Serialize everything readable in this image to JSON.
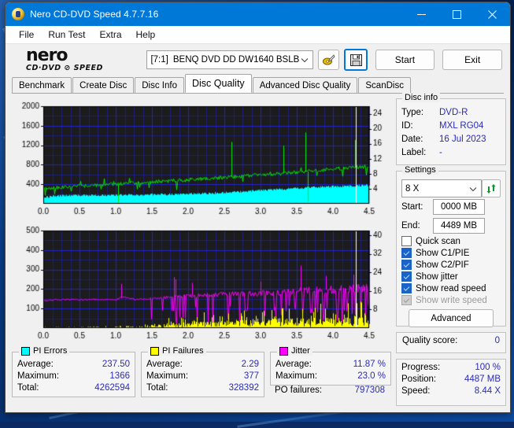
{
  "window": {
    "title": "Nero CD-DVD Speed 4.7.7.16",
    "minimize": "–",
    "maximize": "□",
    "close": "✕"
  },
  "menu": [
    "File",
    "Run Test",
    "Extra",
    "Help"
  ],
  "brand": {
    "word": "nero",
    "sub": "CD·DVD ⊘ SPEED"
  },
  "toolbar": {
    "drive_bracket": "[7:1]",
    "drive_name": "BENQ DVD DD DW1640 BSLB",
    "erase_icon": "erase-disc-icon",
    "save_icon": "save-icon",
    "start_label": "Start",
    "exit_label": "Exit"
  },
  "tabs": [
    {
      "label": "Benchmark",
      "active": false
    },
    {
      "label": "Create Disc",
      "active": false
    },
    {
      "label": "Disc Info",
      "active": false
    },
    {
      "label": "Disc Quality",
      "active": true
    },
    {
      "label": "Advanced Disc Quality",
      "active": false
    },
    {
      "label": "ScanDisc",
      "active": false
    }
  ],
  "disc_info": {
    "title": "Disc info",
    "rows": [
      {
        "label": "Type:",
        "value": "DVD-R"
      },
      {
        "label": "ID:",
        "value": "MXL RG04"
      },
      {
        "label": "Date:",
        "value": "16 Jul 2023"
      },
      {
        "label": "Label:",
        "value": "-"
      }
    ]
  },
  "settings": {
    "title": "Settings",
    "speed": "8 X",
    "refresh_icon": "refresh-icon",
    "start_label": "Start:",
    "start_value": "0000 MB",
    "end_label": "End:",
    "end_value": "4489 MB",
    "checkboxes": [
      {
        "label": "Quick scan",
        "checked": false,
        "disabled": false
      },
      {
        "label": "Show C1/PIE",
        "checked": true,
        "disabled": false
      },
      {
        "label": "Show C2/PIF",
        "checked": true,
        "disabled": false
      },
      {
        "label": "Show jitter",
        "checked": true,
        "disabled": false
      },
      {
        "label": "Show read speed",
        "checked": true,
        "disabled": false
      },
      {
        "label": "Show write speed",
        "checked": true,
        "disabled": true
      }
    ],
    "advanced_label": "Advanced"
  },
  "quality": {
    "label": "Quality score:",
    "value": "0"
  },
  "status": {
    "rows": [
      {
        "label": "Progress:",
        "value": "100 %"
      },
      {
        "label": "Position:",
        "value": "4487 MB"
      },
      {
        "label": "Speed:",
        "value": "8.44 X"
      }
    ]
  },
  "stats": [
    {
      "title": "PI Errors",
      "color": "#00ffff",
      "rows": [
        {
          "label": "Average:",
          "value": "237.50"
        },
        {
          "label": "Maximum:",
          "value": "1366"
        },
        {
          "label": "Total:",
          "value": "4262594"
        }
      ]
    },
    {
      "title": "PI Failures",
      "color": "#ffff00",
      "rows": [
        {
          "label": "Average:",
          "value": "2.29"
        },
        {
          "label": "Maximum:",
          "value": "377"
        },
        {
          "label": "Total:",
          "value": "328392"
        }
      ]
    },
    {
      "title": "Jitter",
      "color": "#ff00ff",
      "rows": [
        {
          "label": "Average:",
          "value": "11.87 %"
        },
        {
          "label": "Maximum:",
          "value": "23.0 %"
        }
      ],
      "extra": {
        "label": "PO failures:",
        "value": "797308"
      }
    }
  ],
  "chart_data": [
    {
      "type": "area",
      "name": "pi-errors-chart",
      "title": "",
      "xlabel": "",
      "ylabel": "PI Errors",
      "xlim": [
        0.0,
        4.5
      ],
      "ylim": [
        0,
        2000
      ],
      "xticks": [
        0.0,
        0.5,
        1.0,
        1.5,
        2.0,
        2.5,
        3.0,
        3.5,
        4.0,
        4.5
      ],
      "xticklabels": [
        "0.0",
        "0.5",
        "1.0",
        "1.5",
        "2.0",
        "2.5",
        "3.0",
        "3.5",
        "4.0",
        "4.5"
      ],
      "yticks": [
        400,
        800,
        1200,
        1600,
        2000
      ],
      "yticklabels": [
        "400",
        "800",
        "1200",
        "1600",
        "2000"
      ],
      "y2lim": [
        0,
        26
      ],
      "y2ticks": [
        4,
        8,
        12,
        16,
        20,
        24
      ],
      "y2ticklabels": [
        "4",
        "8",
        "12",
        "16",
        "20",
        "24"
      ],
      "grid": true,
      "background": "#1c1c1c",
      "gridcolor": "#2020d0",
      "series": [
        {
          "name": "PI Errors",
          "color": "#00ffff",
          "style": "filled-band",
          "axis": "left",
          "x": [
            0.0,
            0.15,
            0.3,
            0.5,
            0.75,
            1.0,
            1.25,
            1.5,
            1.75,
            2.0,
            2.25,
            2.5,
            2.75,
            3.0,
            3.25,
            3.5,
            3.75,
            4.0,
            4.25,
            4.45
          ],
          "values": [
            120,
            150,
            160,
            165,
            168,
            170,
            175,
            180,
            185,
            195,
            205,
            220,
            240,
            265,
            290,
            310,
            330,
            345,
            360,
            370
          ],
          "noise": 42
        },
        {
          "name": "Read speed",
          "color": "#00ee00",
          "style": "line",
          "axis": "right",
          "x": [
            0.0,
            0.15,
            0.3,
            0.5,
            0.75,
            1.0,
            1.25,
            1.5,
            1.75,
            2.0,
            2.25,
            2.5,
            2.75,
            3.0,
            3.25,
            3.5,
            3.75,
            4.0,
            4.25,
            4.45
          ],
          "values": [
            4.0,
            4.3,
            4.5,
            4.7,
            5.0,
            5.2,
            5.5,
            5.8,
            6.1,
            6.4,
            6.7,
            7.0,
            7.3,
            7.6,
            8.0,
            8.4,
            8.8,
            9.2,
            9.6,
            9.9
          ],
          "noise": 1.0
        }
      ],
      "spikes": [
        {
          "series": "Read speed",
          "x": 1.03,
          "value": 0.3
        },
        {
          "series": "Read speed",
          "x": 2.6,
          "value": 16.5
        },
        {
          "series": "Read speed",
          "x": 3.32,
          "value": 15.5
        },
        {
          "series": "Read speed",
          "x": 3.62,
          "value": 19.0
        },
        {
          "series": "Read speed",
          "x": 3.65,
          "value": 0.5
        },
        {
          "series": "Read speed",
          "x": 4.3,
          "value": 17.0
        }
      ]
    },
    {
      "type": "line",
      "name": "jitter-pif-chart",
      "title": "",
      "xlabel": "",
      "ylabel": "PI Failures",
      "xlim": [
        0.0,
        4.5
      ],
      "ylim": [
        0,
        500
      ],
      "xticks": [
        0.0,
        0.5,
        1.0,
        1.5,
        2.0,
        2.5,
        3.0,
        3.5,
        4.0,
        4.5
      ],
      "xticklabels": [
        "0.0",
        "0.5",
        "1.0",
        "1.5",
        "2.0",
        "2.5",
        "3.0",
        "3.5",
        "4.0",
        "4.5"
      ],
      "yticks": [
        100,
        200,
        300,
        400,
        500
      ],
      "yticklabels": [
        "100",
        "200",
        "300",
        "400",
        "500"
      ],
      "y2lim": [
        0,
        42
      ],
      "y2ticks": [
        8,
        16,
        24,
        32,
        40
      ],
      "y2ticklabels": [
        "8",
        "16",
        "24",
        "32",
        "40"
      ],
      "grid": true,
      "background": "#1c1c1c",
      "gridcolor": "#2020d0",
      "series": [
        {
          "name": "Jitter",
          "color": "#ff00ff",
          "style": "line",
          "axis": "right",
          "x": [
            0.0,
            0.25,
            0.5,
            0.75,
            1.0,
            1.1,
            1.25,
            1.4,
            1.5,
            1.75,
            2.0,
            2.25,
            2.5,
            2.75,
            3.0,
            3.25,
            3.5,
            3.75,
            4.0,
            4.25,
            4.45
          ],
          "values": [
            11.8,
            12.3,
            12.2,
            12.3,
            12.2,
            13.5,
            12.4,
            12.5,
            12.8,
            13.4,
            13.8,
            14.2,
            14.6,
            14.8,
            15.0,
            15.4,
            15.8,
            16.2,
            16.6,
            17.0,
            17.4
          ],
          "noise": 0.7
        },
        {
          "name": "PI Failures",
          "color": "#ffff00",
          "style": "spikes",
          "axis": "left",
          "x": [
            0.0,
            0.5,
            1.0,
            1.4,
            1.6,
            1.8,
            2.0,
            2.25,
            2.5,
            2.75,
            3.0,
            3.25,
            3.5,
            3.75,
            4.0,
            4.25,
            4.45
          ],
          "values": [
            2,
            3,
            4,
            6,
            10,
            14,
            18,
            20,
            22,
            24,
            26,
            28,
            30,
            32,
            34,
            36,
            38
          ],
          "noise": 8
        }
      ],
      "dropouts_start": 1.38,
      "spikes": [
        {
          "series": "Jitter",
          "x": 1.08,
          "value": 19.0
        },
        {
          "series": "Jitter",
          "x": 1.8,
          "value": 22.0
        },
        {
          "series": "Jitter",
          "x": 1.83,
          "value": 21.0
        },
        {
          "series": "Jitter",
          "x": 2.05,
          "value": 19.5
        },
        {
          "series": "Jitter",
          "x": 3.0,
          "value": 20.0
        },
        {
          "series": "Jitter",
          "x": 3.55,
          "value": 27.0
        },
        {
          "series": "Jitter",
          "x": 3.9,
          "value": 22.5
        },
        {
          "series": "Jitter",
          "x": 4.28,
          "value": 23.0
        }
      ]
    }
  ]
}
